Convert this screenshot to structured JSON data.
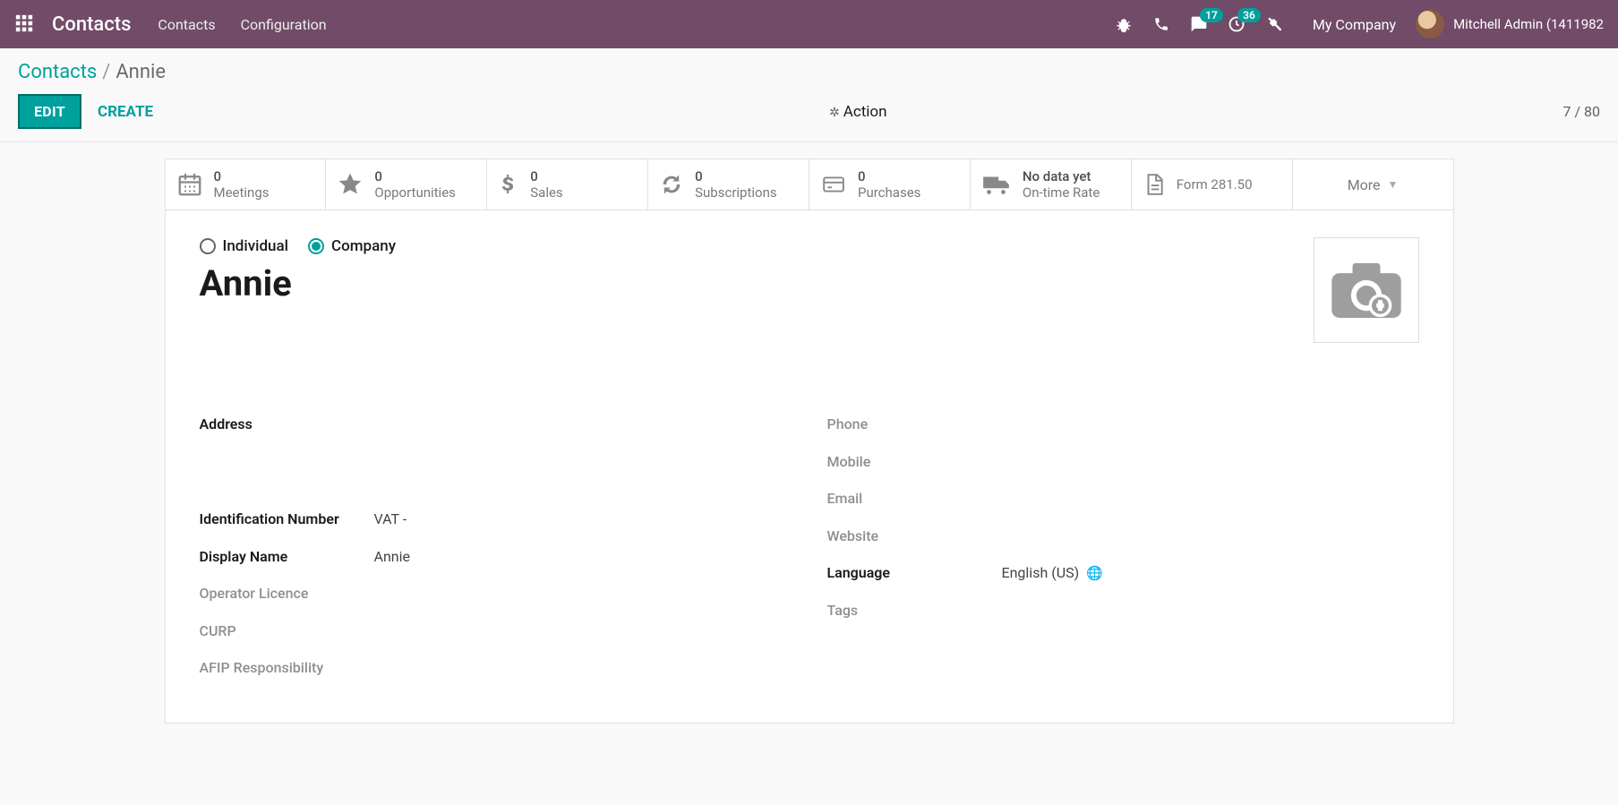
{
  "topbar": {
    "brand": "Contacts",
    "menu": [
      "Contacts",
      "Configuration"
    ],
    "msg_badge": "17",
    "activity_badge": "36",
    "company": "My Company",
    "username": "Mitchell Admin (1411982"
  },
  "breadcrumb": {
    "root": "Contacts",
    "current": "Annie"
  },
  "controls": {
    "edit": "EDIT",
    "create": "CREATE",
    "action": "Action",
    "pager": "7 / 80"
  },
  "stats": [
    {
      "icon": "calendar",
      "value": "0",
      "label": "Meetings"
    },
    {
      "icon": "star",
      "value": "0",
      "label": "Opportunities"
    },
    {
      "icon": "dollar",
      "value": "0",
      "label": "Sales"
    },
    {
      "icon": "refresh",
      "value": "0",
      "label": "Subscriptions"
    },
    {
      "icon": "card",
      "value": "0",
      "label": "Purchases"
    },
    {
      "icon": "truck",
      "value": "No data yet",
      "label": "On-time Rate"
    },
    {
      "icon": "file",
      "value": "",
      "label": "Form 281.50"
    }
  ],
  "more_label": "More",
  "type": {
    "individual": "Individual",
    "company": "Company",
    "selected": "company"
  },
  "record_name": "Annie",
  "fields_left": [
    {
      "label": "Address",
      "muted": false,
      "value": ""
    },
    {
      "label": "Identification Number",
      "muted": false,
      "value": "VAT -"
    },
    {
      "label": "Display Name",
      "muted": false,
      "value": "Annie"
    },
    {
      "label": "Operator Licence",
      "muted": true,
      "value": ""
    },
    {
      "label": "CURP",
      "muted": true,
      "value": ""
    },
    {
      "label": "AFIP Responsibility",
      "muted": true,
      "value": ""
    }
  ],
  "fields_right": [
    {
      "label": "Phone",
      "muted": true,
      "value": ""
    },
    {
      "label": "Mobile",
      "muted": true,
      "value": ""
    },
    {
      "label": "Email",
      "muted": true,
      "value": ""
    },
    {
      "label": "Website",
      "muted": true,
      "value": ""
    },
    {
      "label": "Language",
      "muted": false,
      "value": "English (US)",
      "globe": true
    },
    {
      "label": "Tags",
      "muted": true,
      "value": ""
    }
  ]
}
